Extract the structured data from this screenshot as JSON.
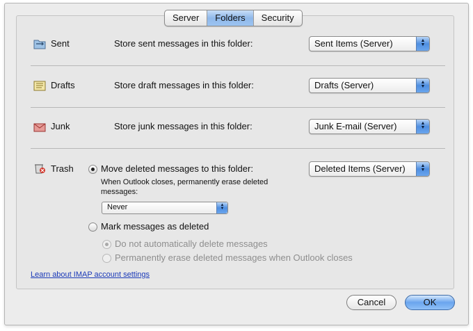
{
  "tabs": [
    {
      "label": "Server",
      "active": false
    },
    {
      "label": "Folders",
      "active": true
    },
    {
      "label": "Security",
      "active": false
    }
  ],
  "folders": {
    "sent": {
      "name": "Sent",
      "icon": "sent-folder-icon",
      "description": "Store sent messages in this folder:",
      "selected": "Sent Items (Server)"
    },
    "drafts": {
      "name": "Drafts",
      "icon": "drafts-folder-icon",
      "description": "Store draft messages in this folder:",
      "selected": "Drafts (Server)"
    },
    "junk": {
      "name": "Junk",
      "icon": "junk-folder-icon",
      "description": "Store junk messages in this folder:",
      "selected": "Junk E-mail (Server)"
    },
    "trash": {
      "name": "Trash",
      "icon": "trash-folder-icon",
      "option_move": "Move deleted messages to this folder:",
      "selected": "Deleted Items (Server)",
      "erase_note_line1": "When Outlook closes, permanently erase deleted",
      "erase_note_line2": "messages:",
      "erase_schedule": "Never",
      "option_mark": "Mark messages as deleted",
      "sub_option_1": "Do not automatically delete messages",
      "sub_option_2": "Permanently erase deleted messages when Outlook closes"
    }
  },
  "link": "Learn about IMAP account settings",
  "buttons": {
    "cancel": "Cancel",
    "ok": "OK"
  },
  "colors": {
    "accent": "#6aa5ee",
    "link": "#1a39b8"
  }
}
